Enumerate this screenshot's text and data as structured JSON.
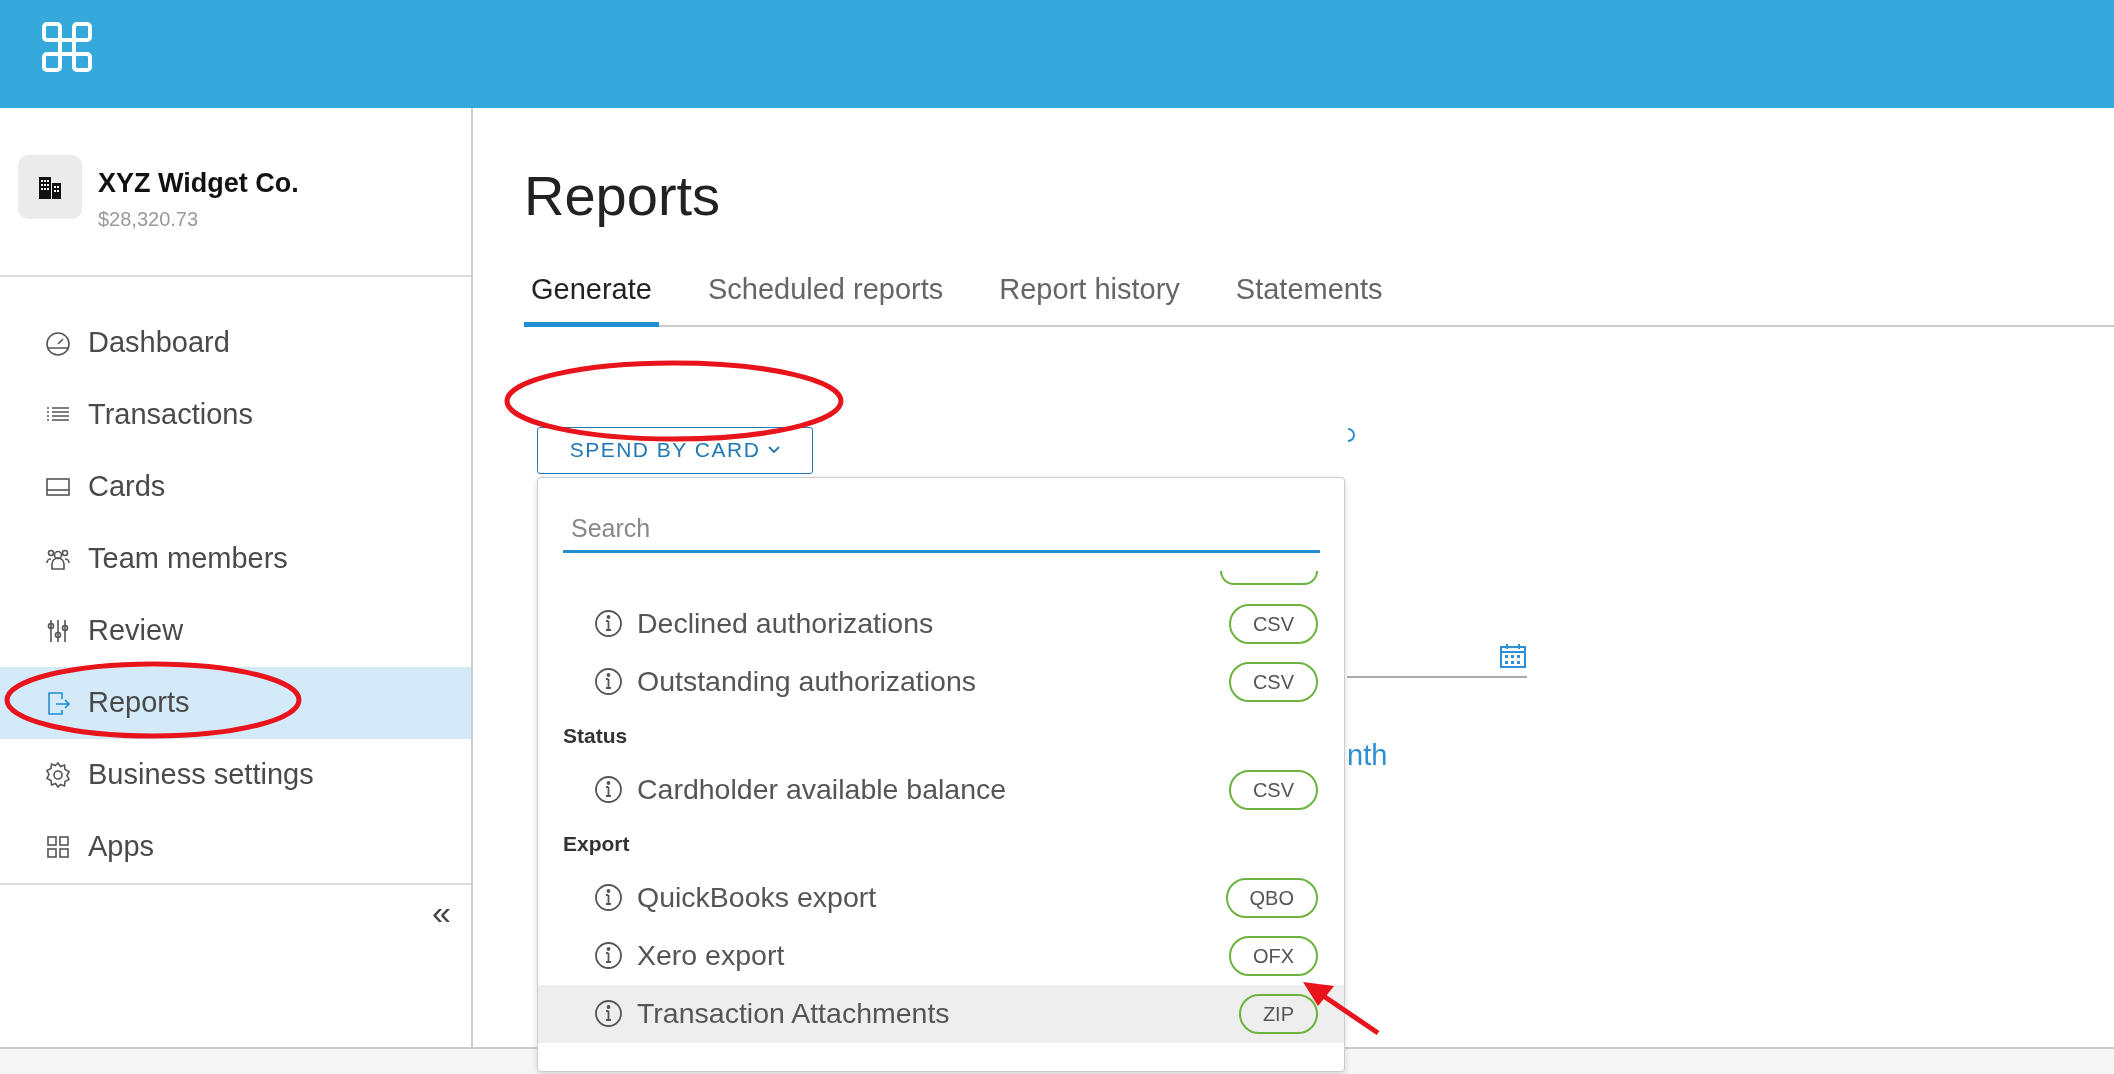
{
  "account": {
    "name": "XYZ Widget Co.",
    "balance": "$28,320.73"
  },
  "sidebar": {
    "items": [
      {
        "label": "Dashboard",
        "selected": false
      },
      {
        "label": "Transactions",
        "selected": false
      },
      {
        "label": "Cards",
        "selected": false
      },
      {
        "label": "Team members",
        "selected": false
      },
      {
        "label": "Review",
        "selected": false
      },
      {
        "label": "Reports",
        "selected": true
      },
      {
        "label": "Business settings",
        "selected": false
      },
      {
        "label": "Apps",
        "selected": false
      }
    ],
    "collapse": "«"
  },
  "page": {
    "title": "Reports",
    "tabs": [
      {
        "label": "Generate",
        "selected": true
      },
      {
        "label": "Scheduled reports",
        "selected": false
      },
      {
        "label": "Report history",
        "selected": false
      },
      {
        "label": "Statements",
        "selected": false
      }
    ]
  },
  "report_type_button": {
    "label": "SPEND BY CARD"
  },
  "dropdown": {
    "search": {
      "placeholder": "Search"
    },
    "items": [
      {
        "kind": "report",
        "label": "Declined authorizations",
        "format": "CSV",
        "hovered": false
      },
      {
        "kind": "report",
        "label": "Outstanding authorizations",
        "format": "CSV",
        "hovered": false
      },
      {
        "kind": "heading",
        "label": "Status"
      },
      {
        "kind": "report",
        "label": "Cardholder available balance",
        "format": "CSV",
        "hovered": false
      },
      {
        "kind": "heading",
        "label": "Export"
      },
      {
        "kind": "report",
        "label": "QuickBooks export",
        "format": "QBO",
        "hovered": false
      },
      {
        "kind": "report",
        "label": "Xero export",
        "format": "OFX",
        "hovered": false
      },
      {
        "kind": "report",
        "label": "Transaction Attachments",
        "format": "ZIP",
        "hovered": true
      }
    ]
  },
  "background": {
    "link_fragment": "nth"
  }
}
